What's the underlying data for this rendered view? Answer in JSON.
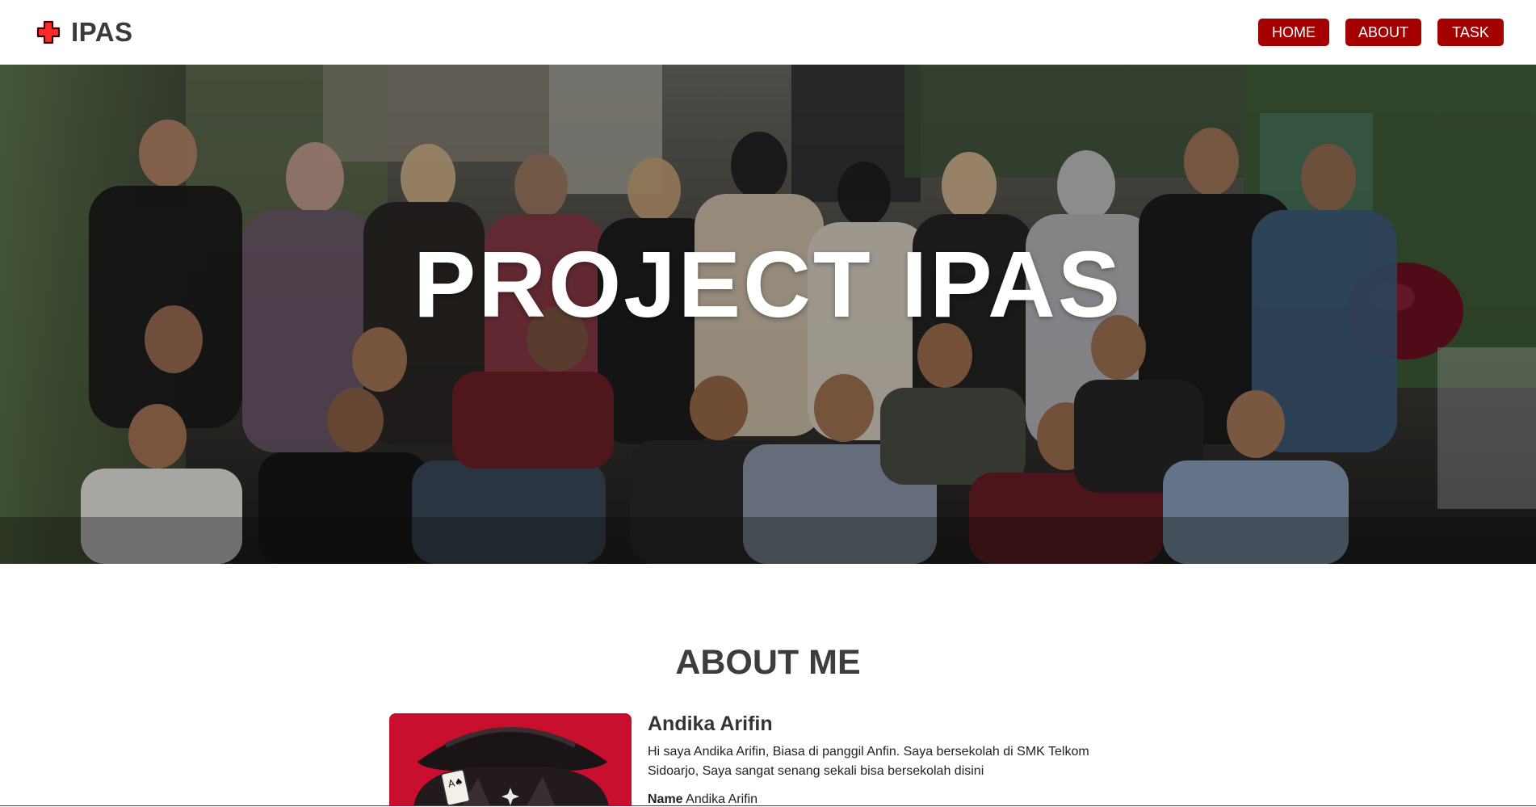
{
  "navbar": {
    "brand": "IPAS",
    "brand_icon": "red-cross-icon",
    "links": [
      {
        "label": "HOME"
      },
      {
        "label": "ABOUT"
      },
      {
        "label": "TASK"
      }
    ],
    "accent_color": "#a50000"
  },
  "hero": {
    "title": "PROJECT IPAS",
    "image": "group-photo"
  },
  "about": {
    "heading": "ABOUT ME",
    "name": "Andika Arifin",
    "bio": "Hi saya Andika Arifin, Biasa di panggil Anfin. Saya bersekolah di SMK Telkom Sidoarjo, Saya sangat senang sekali bisa bersekolah disini",
    "fields": [
      {
        "label": "Name",
        "value": "Andika Arifin"
      }
    ],
    "avatar": "anime-avatar",
    "avatar_bg_color": "#c8102e"
  }
}
